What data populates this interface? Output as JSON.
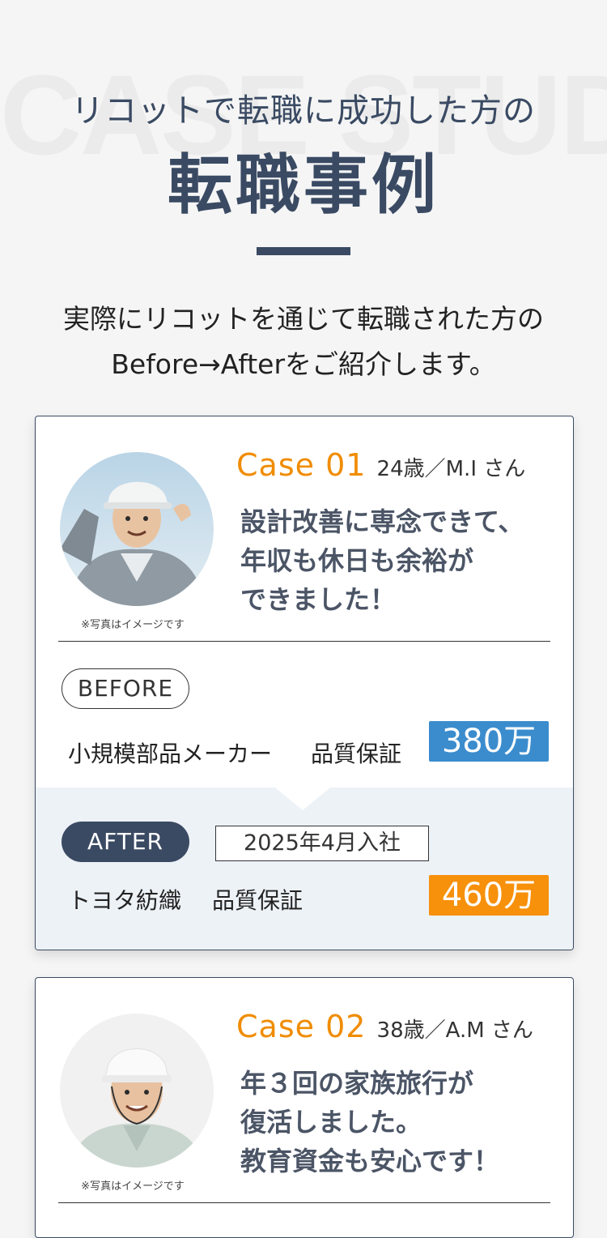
{
  "hero": {
    "watermark": "CASE STUDY",
    "subtitle": "リコットで転職に成功した方の",
    "title": "転職事例",
    "intro_line1": "実際にリコットを通じて転職された方の",
    "intro_line2": "Before→Afterをご紹介します。"
  },
  "cases": [
    {
      "label": "Case 01",
      "person": "24歳／M.I さん",
      "headline": [
        "設計改善に専念できて、",
        "年収も休日も余裕が",
        "できました！"
      ],
      "photo_note": "※写真はイメージです",
      "before": {
        "badge": "BEFORE",
        "company": "小規模部品メーカー",
        "role": "品質保証",
        "salary": "380万"
      },
      "after": {
        "badge": "AFTER",
        "date": "2025年4月入社",
        "company": "トヨタ紡織",
        "role": "品質保証",
        "salary": "460万"
      }
    },
    {
      "label": "Case 02",
      "person": "38歳／A.M さん",
      "headline": [
        "年３回の家族旅行が",
        "復活しました。",
        "教育資金も安心です！"
      ],
      "photo_note": "※写真はイメージです"
    }
  ],
  "colors": {
    "navy": "#3a4a63",
    "orange": "#f08c00",
    "salary_before": "#3b8ccd",
    "salary_after": "#f7900a",
    "after_bg": "#edf2f7"
  }
}
